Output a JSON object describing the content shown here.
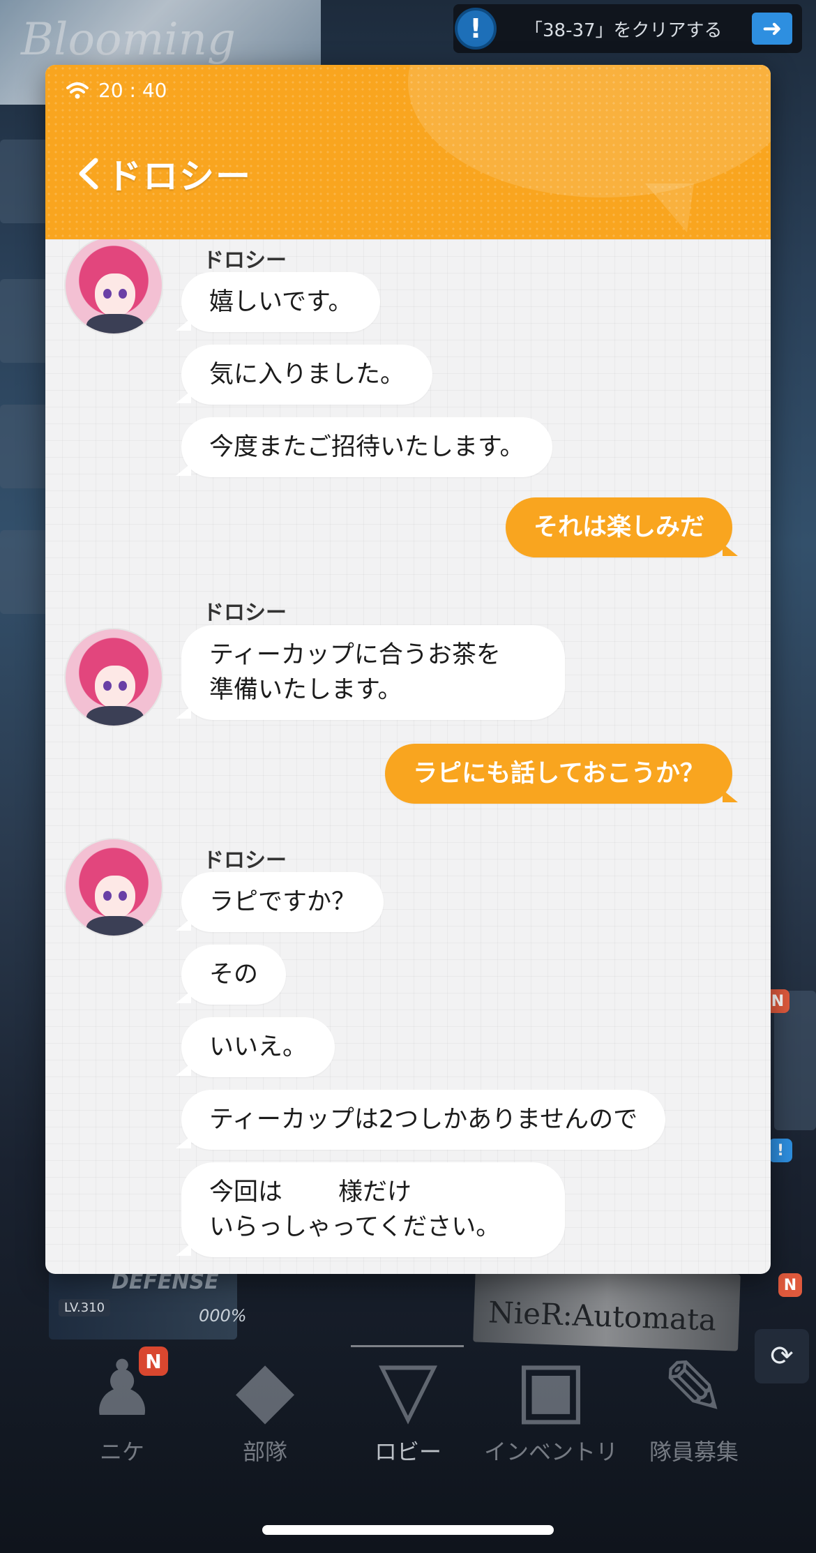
{
  "background": {
    "logo_text": "Blooming",
    "quest_bar": {
      "icon": "!",
      "text": "「38-37」をクリアする",
      "go_icon": "arrow-right-icon"
    },
    "defense": {
      "label": "DEFENSE",
      "level": "LV.310",
      "percent": "000%"
    },
    "automata_banner": "NieR:Automata",
    "badges": {
      "n": "N",
      "alert": "!"
    }
  },
  "phone": {
    "status": {
      "time": "20 : 40"
    },
    "header": {
      "back_icon": "chevron-left-icon",
      "contact_name": "ドロシー"
    },
    "messages": [
      {
        "from": "ドロシー",
        "lines": [
          "嬉しいです。",
          "気に入りました。",
          "今度またご招待いたします。"
        ]
      },
      {
        "from": "me",
        "text": "それは楽しみだ"
      },
      {
        "from": "ドロシー",
        "lines": [
          "ティーカップに合うお茶を\n準備いたします。"
        ]
      },
      {
        "from": "me",
        "text": "ラピにも話しておこうか？"
      },
      {
        "from": "ドロシー",
        "lines": [
          "ラピですか？",
          "その",
          "いいえ。",
          "ティーカップは2つしかありませんので"
        ]
      }
    ],
    "last_message": {
      "pre": "今回は",
      "post": "様だけ",
      "line2": "いらっしゃってください。"
    }
  },
  "nav": {
    "items": [
      {
        "label": "ニケ",
        "icon": "nikke-icon",
        "badge": "N"
      },
      {
        "label": "部隊",
        "icon": "squad-icon"
      },
      {
        "label": "ロビー",
        "icon": "lobby-icon",
        "active": true
      },
      {
        "label": "インベントリ",
        "icon": "inventory-icon"
      },
      {
        "label": "隊員募集",
        "icon": "recruit-icon"
      }
    ]
  },
  "colors": {
    "accent": "#f9a51f",
    "bubble_in": "#ffffff",
    "chat_bg": "#f2f2f3"
  }
}
